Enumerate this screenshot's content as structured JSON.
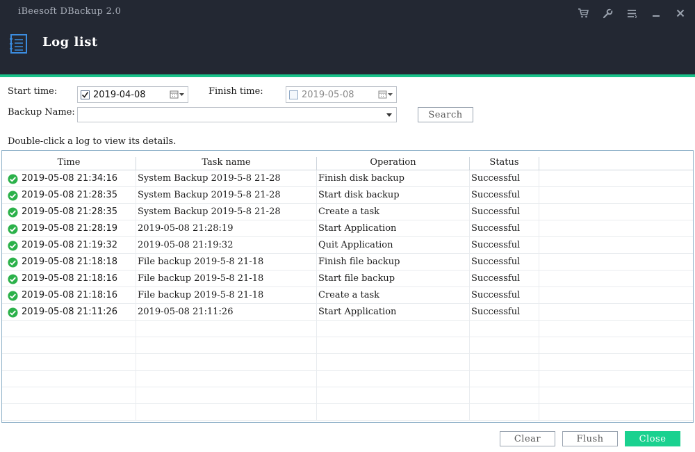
{
  "window": {
    "app_title": "iBeesoft DBackup 2.0",
    "page_title": "Log list"
  },
  "header_icons": [
    "cart-icon",
    "wrench-icon",
    "menu-icon",
    "minimize-icon",
    "close-icon"
  ],
  "filters": {
    "start_label": "Start time:",
    "start_checked": true,
    "start_date": "2019-04-08",
    "finish_label": "Finish time:",
    "finish_checked": false,
    "finish_date": "2019-05-08",
    "backup_name_label": "Backup Name:",
    "backup_name_value": "",
    "search_label": "Search"
  },
  "hint": "Double-click a log to view its details.",
  "table": {
    "columns": [
      "Time",
      "Task name",
      "Operation",
      "Status"
    ],
    "rows": [
      {
        "time": "2019-05-08 21:34:16",
        "task": "System Backup 2019-5-8 21-28",
        "operation": "Finish disk backup",
        "status": "Successful"
      },
      {
        "time": "2019-05-08 21:28:35",
        "task": "System Backup 2019-5-8 21-28",
        "operation": "Start disk backup",
        "status": "Successful"
      },
      {
        "time": "2019-05-08 21:28:35",
        "task": "System Backup 2019-5-8 21-28",
        "operation": "Create a task",
        "status": "Successful"
      },
      {
        "time": "2019-05-08 21:28:19",
        "task": "2019-05-08 21:28:19",
        "operation": "Start Application",
        "status": "Successful"
      },
      {
        "time": "2019-05-08 21:19:32",
        "task": "2019-05-08 21:19:32",
        "operation": "Quit Application",
        "status": "Successful"
      },
      {
        "time": "2019-05-08 21:18:18",
        "task": "File backup 2019-5-8 21-18",
        "operation": "Finish file backup",
        "status": "Successful"
      },
      {
        "time": "2019-05-08 21:18:16",
        "task": "File backup 2019-5-8 21-18",
        "operation": "Start file backup",
        "status": "Successful"
      },
      {
        "time": "2019-05-08 21:18:16",
        "task": "File backup 2019-5-8 21-18",
        "operation": "Create a task",
        "status": "Successful"
      },
      {
        "time": "2019-05-08 21:11:26",
        "task": "2019-05-08 21:11:26",
        "operation": "Start Application",
        "status": "Successful"
      }
    ]
  },
  "footer": {
    "clear_label": "Clear",
    "flush_label": "Flush",
    "close_label": "Close"
  },
  "colors": {
    "header_bg": "#232833",
    "accent": "#19c28a",
    "success": "#2bb14a"
  }
}
